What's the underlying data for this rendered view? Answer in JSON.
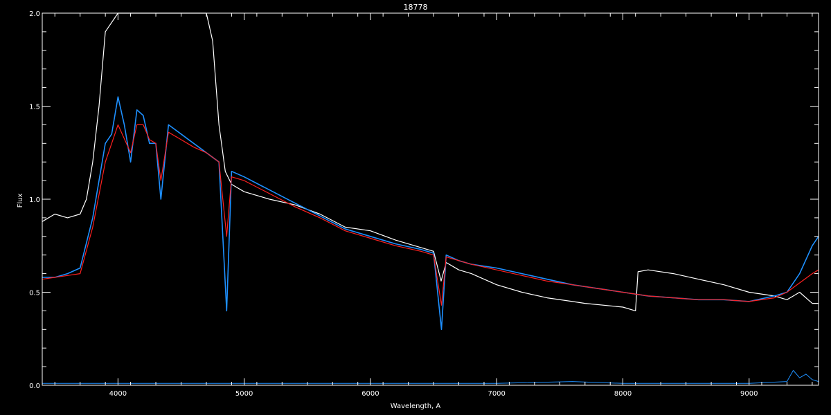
{
  "chart_data": {
    "type": "line",
    "title": "18778",
    "xlabel": "Wavelength, A",
    "ylabel": "Flux",
    "xlim": [
      3400,
      9550
    ],
    "ylim": [
      0.0,
      2.0
    ],
    "x_ticks": [
      4000,
      5000,
      6000,
      7000,
      8000,
      9000
    ],
    "y_ticks": [
      0.0,
      0.5,
      1.0,
      1.5,
      2.0
    ],
    "y_tick_labels": [
      "0.0",
      "0.5",
      "1.0",
      "1.5",
      "2.0"
    ],
    "grid": false,
    "legend": "none",
    "colors": {
      "background": "#000000",
      "axes": "#ffffff",
      "observed": "#ffffff",
      "model": "#1e90ff",
      "fit": "#ff2020",
      "residual": "#1e90ff"
    },
    "series": [
      {
        "key": "observed",
        "x": [
          3400,
          3500,
          3600,
          3700,
          3750,
          3800,
          3850,
          3900,
          4000,
          4100,
          4200,
          4300,
          4400,
          4500,
          4600,
          4700,
          4750,
          4800,
          4850,
          4900,
          5000,
          5200,
          5400,
          5600,
          5800,
          6000,
          6200,
          6400,
          6500,
          6560,
          6600,
          6700,
          6800,
          7000,
          7200,
          7400,
          7600,
          7700,
          8000,
          8100,
          8120,
          8200,
          8400,
          8600,
          8800,
          9000,
          9200,
          9300,
          9400,
          9500,
          9550
        ],
        "y": [
          0.88,
          0.92,
          0.9,
          0.92,
          1.0,
          1.2,
          1.5,
          1.9,
          2.0,
          2.0,
          2.0,
          2.0,
          2.0,
          2.0,
          2.0,
          2.0,
          1.85,
          1.4,
          1.15,
          1.08,
          1.04,
          1.0,
          0.97,
          0.92,
          0.85,
          0.83,
          0.78,
          0.74,
          0.72,
          0.56,
          0.66,
          0.62,
          0.6,
          0.54,
          0.5,
          0.47,
          0.45,
          0.44,
          0.42,
          0.4,
          0.61,
          0.62,
          0.6,
          0.57,
          0.54,
          0.5,
          0.48,
          0.46,
          0.5,
          0.44,
          0.44
        ]
      },
      {
        "key": "model",
        "x": [
          3400,
          3500,
          3600,
          3700,
          3800,
          3900,
          3950,
          4000,
          4050,
          4100,
          4150,
          4200,
          4250,
          4300,
          4340,
          4400,
          4500,
          4600,
          4700,
          4800,
          4861,
          4900,
          5000,
          5200,
          5400,
          5600,
          5800,
          6000,
          6200,
          6400,
          6500,
          6563,
          6600,
          6700,
          6800,
          7000,
          7200,
          7400,
          7600,
          7800,
          8000,
          8200,
          8400,
          8600,
          8800,
          9000,
          9200,
          9300,
          9400,
          9500,
          9550
        ],
        "y": [
          0.58,
          0.58,
          0.6,
          0.63,
          0.9,
          1.3,
          1.35,
          1.55,
          1.4,
          1.2,
          1.48,
          1.45,
          1.3,
          1.3,
          1.0,
          1.4,
          1.35,
          1.3,
          1.25,
          1.2,
          0.4,
          1.15,
          1.12,
          1.05,
          0.98,
          0.91,
          0.84,
          0.8,
          0.76,
          0.73,
          0.71,
          0.3,
          0.7,
          0.67,
          0.65,
          0.63,
          0.6,
          0.57,
          0.54,
          0.52,
          0.5,
          0.48,
          0.47,
          0.46,
          0.46,
          0.45,
          0.48,
          0.5,
          0.6,
          0.75,
          0.8
        ]
      },
      {
        "key": "fit",
        "x": [
          3400,
          3500,
          3600,
          3700,
          3800,
          3900,
          3950,
          4000,
          4100,
          4150,
          4200,
          4250,
          4300,
          4340,
          4400,
          4500,
          4600,
          4700,
          4800,
          4861,
          4900,
          5000,
          5200,
          5400,
          5600,
          5800,
          6000,
          6200,
          6400,
          6500,
          6563,
          6600,
          6700,
          6800,
          7000,
          7200,
          7400,
          7600,
          7800,
          8000,
          8200,
          8400,
          8600,
          8800,
          9000,
          9200,
          9300,
          9400,
          9500,
          9550
        ],
        "y": [
          0.57,
          0.58,
          0.59,
          0.6,
          0.85,
          1.2,
          1.3,
          1.4,
          1.25,
          1.4,
          1.4,
          1.32,
          1.3,
          1.1,
          1.36,
          1.32,
          1.28,
          1.25,
          1.2,
          0.8,
          1.12,
          1.1,
          1.03,
          0.96,
          0.9,
          0.83,
          0.79,
          0.75,
          0.72,
          0.7,
          0.43,
          0.69,
          0.67,
          0.65,
          0.62,
          0.59,
          0.56,
          0.54,
          0.52,
          0.5,
          0.48,
          0.47,
          0.46,
          0.46,
          0.45,
          0.47,
          0.5,
          0.55,
          0.6,
          0.62
        ]
      },
      {
        "key": "residual",
        "x": [
          3400,
          4000,
          5000,
          6000,
          7000,
          7600,
          8000,
          9000,
          9300,
          9350,
          9400,
          9450,
          9500,
          9550
        ],
        "y": [
          0.01,
          0.01,
          0.01,
          0.01,
          0.01,
          0.02,
          0.01,
          0.01,
          0.02,
          0.08,
          0.04,
          0.06,
          0.03,
          0.02
        ]
      }
    ]
  }
}
